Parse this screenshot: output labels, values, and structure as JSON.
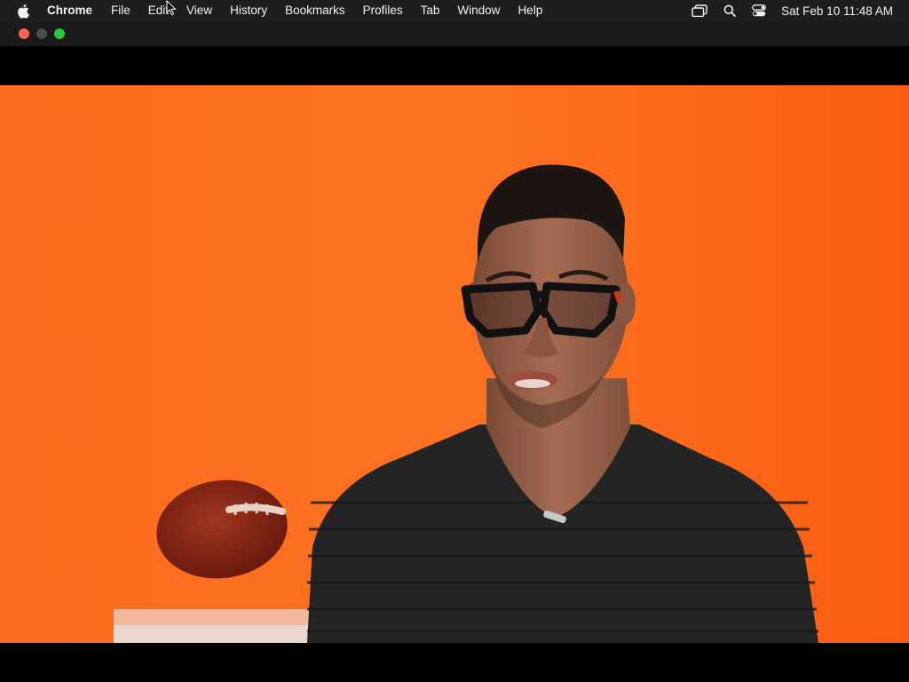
{
  "menubar": {
    "apple_icon": "apple-logo-icon",
    "app_name": "Chrome",
    "items": [
      "File",
      "Edit",
      "View",
      "History",
      "Bookmarks",
      "Profiles",
      "Tab",
      "Window",
      "Help"
    ],
    "status_icons": [
      "screen-mirroring-icon",
      "spotlight-search-icon",
      "control-center-icon"
    ],
    "clock": "Sat Feb 10  11:48 AM"
  },
  "window": {
    "traffic_lights": {
      "close_color": "#ff5f57",
      "minimize_color": "#4a4a4a",
      "zoom_color": "#28c840"
    }
  },
  "video": {
    "background_color": "#fb6a1c",
    "scene": "man-in-black-glasses-and-black-tshirt-with-football",
    "props": [
      "football-icon"
    ]
  },
  "colors": {
    "menubar_bg": "#1e1e1e",
    "titlebar_bg": "#1a1a1a",
    "letterbox": "#000000"
  }
}
